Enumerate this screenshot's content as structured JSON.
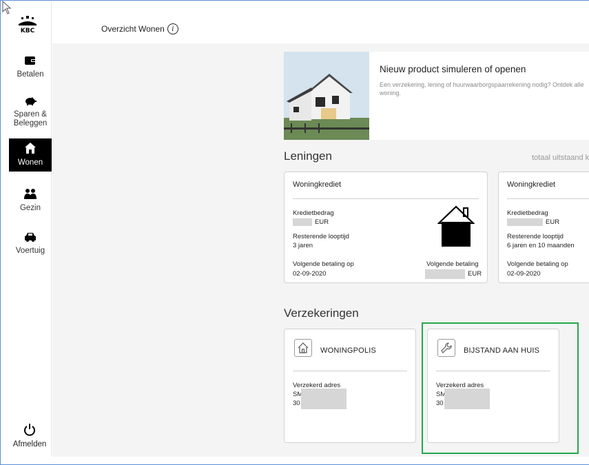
{
  "header": {
    "crumb": "Overzicht Wonen",
    "logo_text": "KBC"
  },
  "nav": {
    "items": [
      {
        "label": "Betalen",
        "icon": "wallet-icon"
      },
      {
        "label": "Sparen & Beleggen",
        "icon": "piggy-bank-icon"
      },
      {
        "label": "Wonen",
        "icon": "house-icon",
        "active": true
      },
      {
        "label": "Gezin",
        "icon": "family-icon"
      },
      {
        "label": "Voertuig",
        "icon": "car-icon"
      }
    ],
    "logout": "Afmelden"
  },
  "promo": {
    "title": "Nieuw product simuleren of openen",
    "text": "Een verzekering, lening of huurwaarborgspaarrekening nodig? Ontdek alle woning."
  },
  "loans": {
    "title": "Leningen",
    "right": "totaal uitstaand k",
    "cards": [
      {
        "title": "Woningkrediet",
        "amount_label": "Kredietbedrag",
        "amount_currency": "EUR",
        "term_label": "Resterende looptijd",
        "term_value": "3 jaren",
        "next_label": "Volgende betaling op",
        "next_date": "02-09-2020",
        "next_amount_label": "Volgende betaling",
        "next_amount_currency": "EUR"
      },
      {
        "title": "Woningkrediet",
        "amount_label": "Kredietbedrag",
        "amount_currency": "EUR",
        "term_label": "Resterende looptijd",
        "term_value": "6 jaren en 10 maanden",
        "next_label": "Volgende betaling op",
        "next_date": "02-09-2020"
      }
    ]
  },
  "insurance": {
    "title": "Verzekeringen",
    "cards": [
      {
        "title": "WONINGPOLIS",
        "icon": "home-outline-icon",
        "addr_label": "Verzekerd adres",
        "addr_line1": "SM",
        "addr_line2": "30"
      },
      {
        "title": "BIJSTAND AAN HUIS",
        "icon": "wrench-icon",
        "addr_label": "Verzekerd adres",
        "addr_line1": "SM",
        "addr_line2": "30"
      }
    ]
  },
  "colors": {
    "highlight": "#23a84a",
    "active_nav": "#000000",
    "main_bg": "#f4f4f4"
  }
}
